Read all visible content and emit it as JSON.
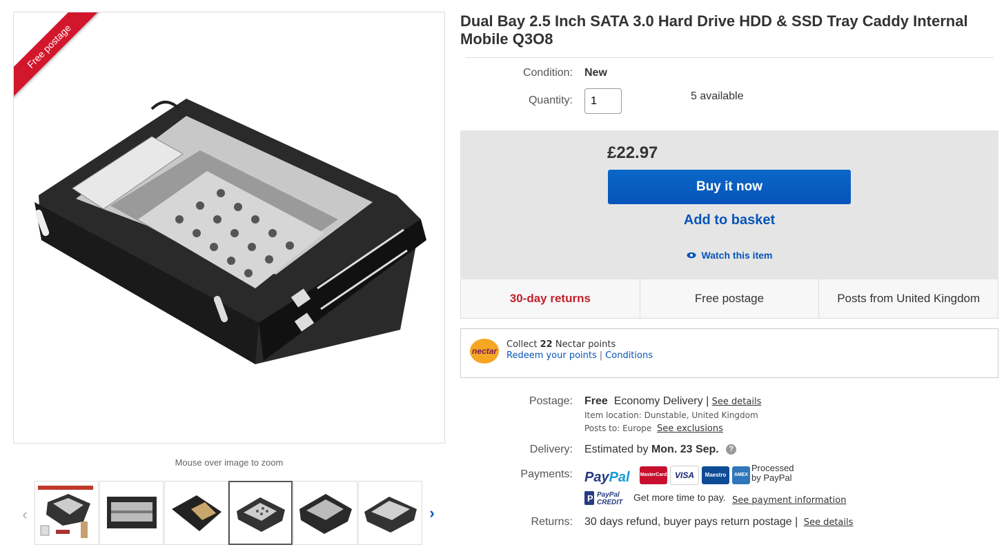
{
  "gallery": {
    "ribbon": "Free postage",
    "zoom_hint": "Mouse over image to zoom",
    "prev_icon": "‹",
    "next_icon": "›",
    "thumbnail_count": 6,
    "selected_thumbnail": 4
  },
  "product": {
    "title": "Dual Bay 2.5 Inch SATA 3.0 Hard Drive HDD & SSD Tray Caddy Internal Mobile Q3O8",
    "condition_label": "Condition:",
    "condition_value": "New",
    "quantity_label": "Quantity:",
    "quantity_value": "1",
    "available": "5 available"
  },
  "buy": {
    "price": "£22.97",
    "buy_now": "Buy it now",
    "add_basket": "Add to basket",
    "watch": "Watch this item"
  },
  "features": [
    "30-day returns",
    "Free postage",
    "Posts from United Kingdom"
  ],
  "nectar": {
    "logo_text": "nectar",
    "collect_prefix": "Collect",
    "points": "22",
    "collect_suffix": "Nectar points",
    "redeem": "Redeem your points",
    "separator": "|",
    "conditions": "Conditions"
  },
  "postage": {
    "label": "Postage:",
    "free": "Free",
    "service": "Economy Delivery |",
    "see_details": "See details",
    "location_label": "Item location:",
    "location": "Dunstable, United Kingdom",
    "posts_to_label": "Posts to:",
    "posts_to": "Europe",
    "see_exclusions": "See exclusions"
  },
  "delivery": {
    "label": "Delivery:",
    "prefix": "Estimated by",
    "date": "Mon. 23 Sep.",
    "help": "?"
  },
  "payments": {
    "label": "Payments:",
    "paypal_a": "Pay",
    "paypal_b": "Pal",
    "cards": [
      "MasterCard",
      "VISA",
      "Maestro",
      "AMEX"
    ],
    "processed_line1": "Processed",
    "processed_line2": "by PayPal",
    "credit_a": "PayPal",
    "credit_b": "CREDIT",
    "more_time": "Get more time to pay.",
    "see_info": "See payment information"
  },
  "returns": {
    "label": "Returns:",
    "text": "30 days refund, buyer pays return postage |",
    "see_details": "See details"
  },
  "colors": {
    "link_blue": "#0654ba",
    "ribbon_red": "#d2162c",
    "returns_red": "#c4202a"
  }
}
